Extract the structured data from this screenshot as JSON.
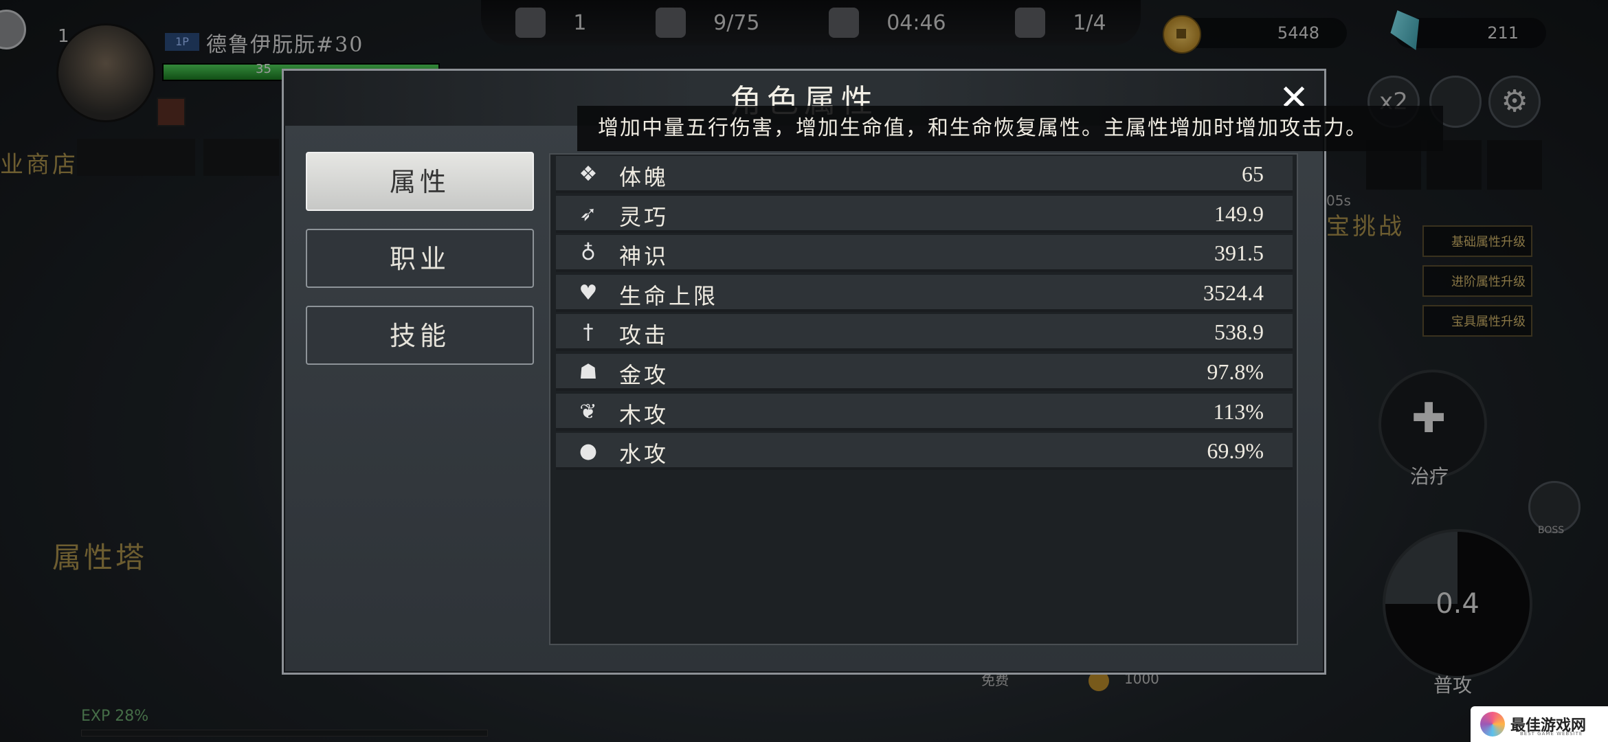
{
  "hud": {
    "kills": "1",
    "hp_count": "9/75",
    "timer": "04:46",
    "boss_count": "1/4",
    "coins": "5448",
    "gems": "211",
    "speed": "x2"
  },
  "player": {
    "level": "1",
    "slot": "1P",
    "name": "德鲁伊朊朊#30",
    "hp_text": "35",
    "hp_fraction": 1.0
  },
  "background": {
    "shop_label": "业商店",
    "tower_label": "属性塔",
    "challenge_label": "宝挑战",
    "exp_text": "EXP 28%",
    "cooldown_text": "05s",
    "upgrade_cards": [
      "基础属性升级",
      "进阶属性升级",
      "宝具属性升级"
    ],
    "heal_label": "治疗",
    "attack_label": "普攻",
    "attack_cooldown": "0.4",
    "boss_label": "BOSS",
    "free_label": "免费",
    "price": "1000"
  },
  "modal": {
    "title": "角色属性",
    "tooltip": "增加中量五行伤害，增加生命值，和生命恢复属性。主属性增加时增加攻击力。",
    "tabs": [
      {
        "label": "属性",
        "active": true
      },
      {
        "label": "职业",
        "active": false
      },
      {
        "label": "技能",
        "active": false
      }
    ],
    "stats": [
      {
        "icon": "constitution-icon",
        "glyph": "❖",
        "name": "体魄",
        "value": "65"
      },
      {
        "icon": "agility-icon",
        "glyph": "➶",
        "name": "灵巧",
        "value": "149.9"
      },
      {
        "icon": "spirit-icon",
        "glyph": "♁",
        "name": "神识",
        "value": "391.5"
      },
      {
        "icon": "heart-icon",
        "glyph": "♥",
        "name": "生命上限",
        "value": "3524.4"
      },
      {
        "icon": "sword-icon",
        "glyph": "†",
        "name": "攻击",
        "value": "538.9"
      },
      {
        "icon": "metal-icon",
        "glyph": "☗",
        "name": "金攻",
        "value": "97.8%"
      },
      {
        "icon": "leaf-icon",
        "glyph": "❦",
        "name": "木攻",
        "value": "113%"
      },
      {
        "icon": "water-drop-icon",
        "glyph": "●",
        "name": "水攻",
        "value": "69.9%"
      }
    ]
  },
  "watermark": {
    "text": "最佳游戏网",
    "sub": "BEST GAME WEBSITE"
  }
}
